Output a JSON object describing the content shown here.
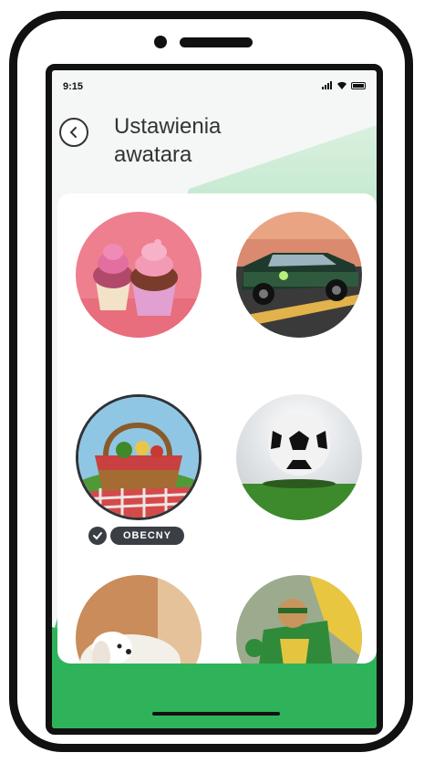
{
  "status": {
    "time": "9:15"
  },
  "header": {
    "title_line1": "Ustawienia",
    "title_line2": "awatara",
    "back_icon": "chevron-left-icon"
  },
  "avatars": [
    {
      "id": "cupcakes",
      "label": "cupcakes"
    },
    {
      "id": "car",
      "label": "car"
    },
    {
      "id": "picnic-basket",
      "label": "picnic basket",
      "current": true
    },
    {
      "id": "football",
      "label": "football"
    },
    {
      "id": "dog",
      "label": "dog"
    },
    {
      "id": "superhero",
      "label": "superhero"
    }
  ],
  "current_badge": {
    "label": "OBECNY"
  },
  "colors": {
    "accent_green": "#2fb35a",
    "dark": "#3a3f45"
  }
}
